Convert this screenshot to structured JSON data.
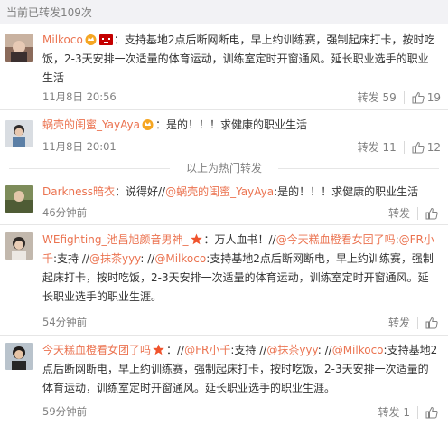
{
  "header": {
    "repost_count_text": "当前已转发109次"
  },
  "posts": [
    {
      "user": "Milkoco",
      "colon": "：",
      "text": "支持基地2点后断网断电，早上约训练赛，强制起床打卡，按时吃饭，2-3天安排一次适量的体育运动，训练室定时开窗通风。延长职业选手的职业生活",
      "time": "11月8日 20:56",
      "repost_label": "转发 59",
      "like_count": "19"
    },
    {
      "user": "蜗壳的闺蜜_YayAya",
      "colon": "：",
      "text": "是的！！！求健康的职业生活",
      "time": "11月8日 20:01",
      "repost_label": "转发 11",
      "like_count": "12"
    },
    {
      "user": "Darkness暗衣",
      "text_a": "：说得好//",
      "mention1": "@蜗壳的闺蜜_YayAya",
      "text_b": ":是的！！！求健康的职业生活",
      "time": "46分钟前",
      "repost_label": "转发",
      "like_count": ""
    },
    {
      "user": "WEfighting_池昌旭颜音男神_",
      "text_a": "：万人血书！//",
      "mention1": "@今天糕血橙看女团了吗",
      "text_b": ":",
      "mention2": "@FR小千",
      "text_c": ":支持 //",
      "mention3": "@抹茶yyy",
      "text_d": ": //",
      "mention4": "@Milkoco",
      "text_e": ":支持基地2点后断网断电，早上约训练赛，强制起床打卡，按时吃饭，2-3天安排一次适量的体育运动，训练室定时开窗通风。延长职业选手的职业生涯。",
      "time": "54分钟前",
      "repost_label": "转发",
      "like_count": ""
    },
    {
      "user": "今天糕血橙看女团了吗",
      "text_a": "：//",
      "mention1": "@FR小千",
      "text_b": ":支持 //",
      "mention2": "@抹茶yyy",
      "text_c": ": //",
      "mention3": "@Milkoco",
      "text_d": ":支持基地2点后断网断电，早上约训练赛，强制起床打卡，按时吃饭，2-3天安排一次适量的体育运动，训练室定时开窗通风。延长职业选手的职业生涯。",
      "time": "59分钟前",
      "repost_label": "转发 1",
      "like_count": ""
    }
  ],
  "hot_divider": "以上为热门转发",
  "colors": {
    "link": "#eb7350",
    "meta": "#808080",
    "text": "#333333",
    "divider": "#e6e6e6"
  },
  "icons": [
    "like-thumb-icon",
    "verified-badge-icon",
    "member-crown-icon",
    "tmall-badge-icon"
  ]
}
